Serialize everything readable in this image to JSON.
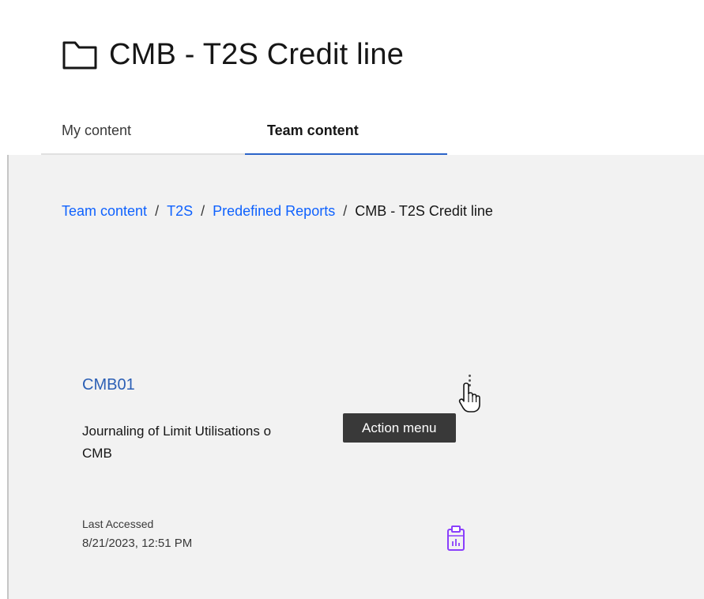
{
  "header": {
    "title": "CMB - T2S Credit line",
    "title_icon": "folder-icon"
  },
  "tabs": [
    {
      "label": "My content",
      "active": false
    },
    {
      "label": "Team content",
      "active": true
    }
  ],
  "breadcrumb": {
    "items": [
      {
        "label": "Team content",
        "link": true
      },
      {
        "label": "T2S",
        "link": true
      },
      {
        "label": "Predefined Reports",
        "link": true
      },
      {
        "label": "CMB - T2S Credit line",
        "link": false
      }
    ],
    "separator": "/"
  },
  "card": {
    "title": "CMB01",
    "description": "Journaling of Limit Utilisations o",
    "description_line2": "CMB",
    "last_accessed_label": "Last Accessed",
    "last_accessed_value": "8/21/2023, 12:51 PM",
    "action_menu_icon": "overflow-menu-vertical-icon",
    "type_icon": "report-icon"
  },
  "tooltip": {
    "text": "Action menu"
  },
  "colors": {
    "link": "#0f62fe",
    "card_title": "#2b5fb5",
    "active_tab_underline": "#2b64c9",
    "content_background": "#f2f2f2",
    "tooltip_background": "#393939",
    "report_icon": "#8a3ffc"
  }
}
